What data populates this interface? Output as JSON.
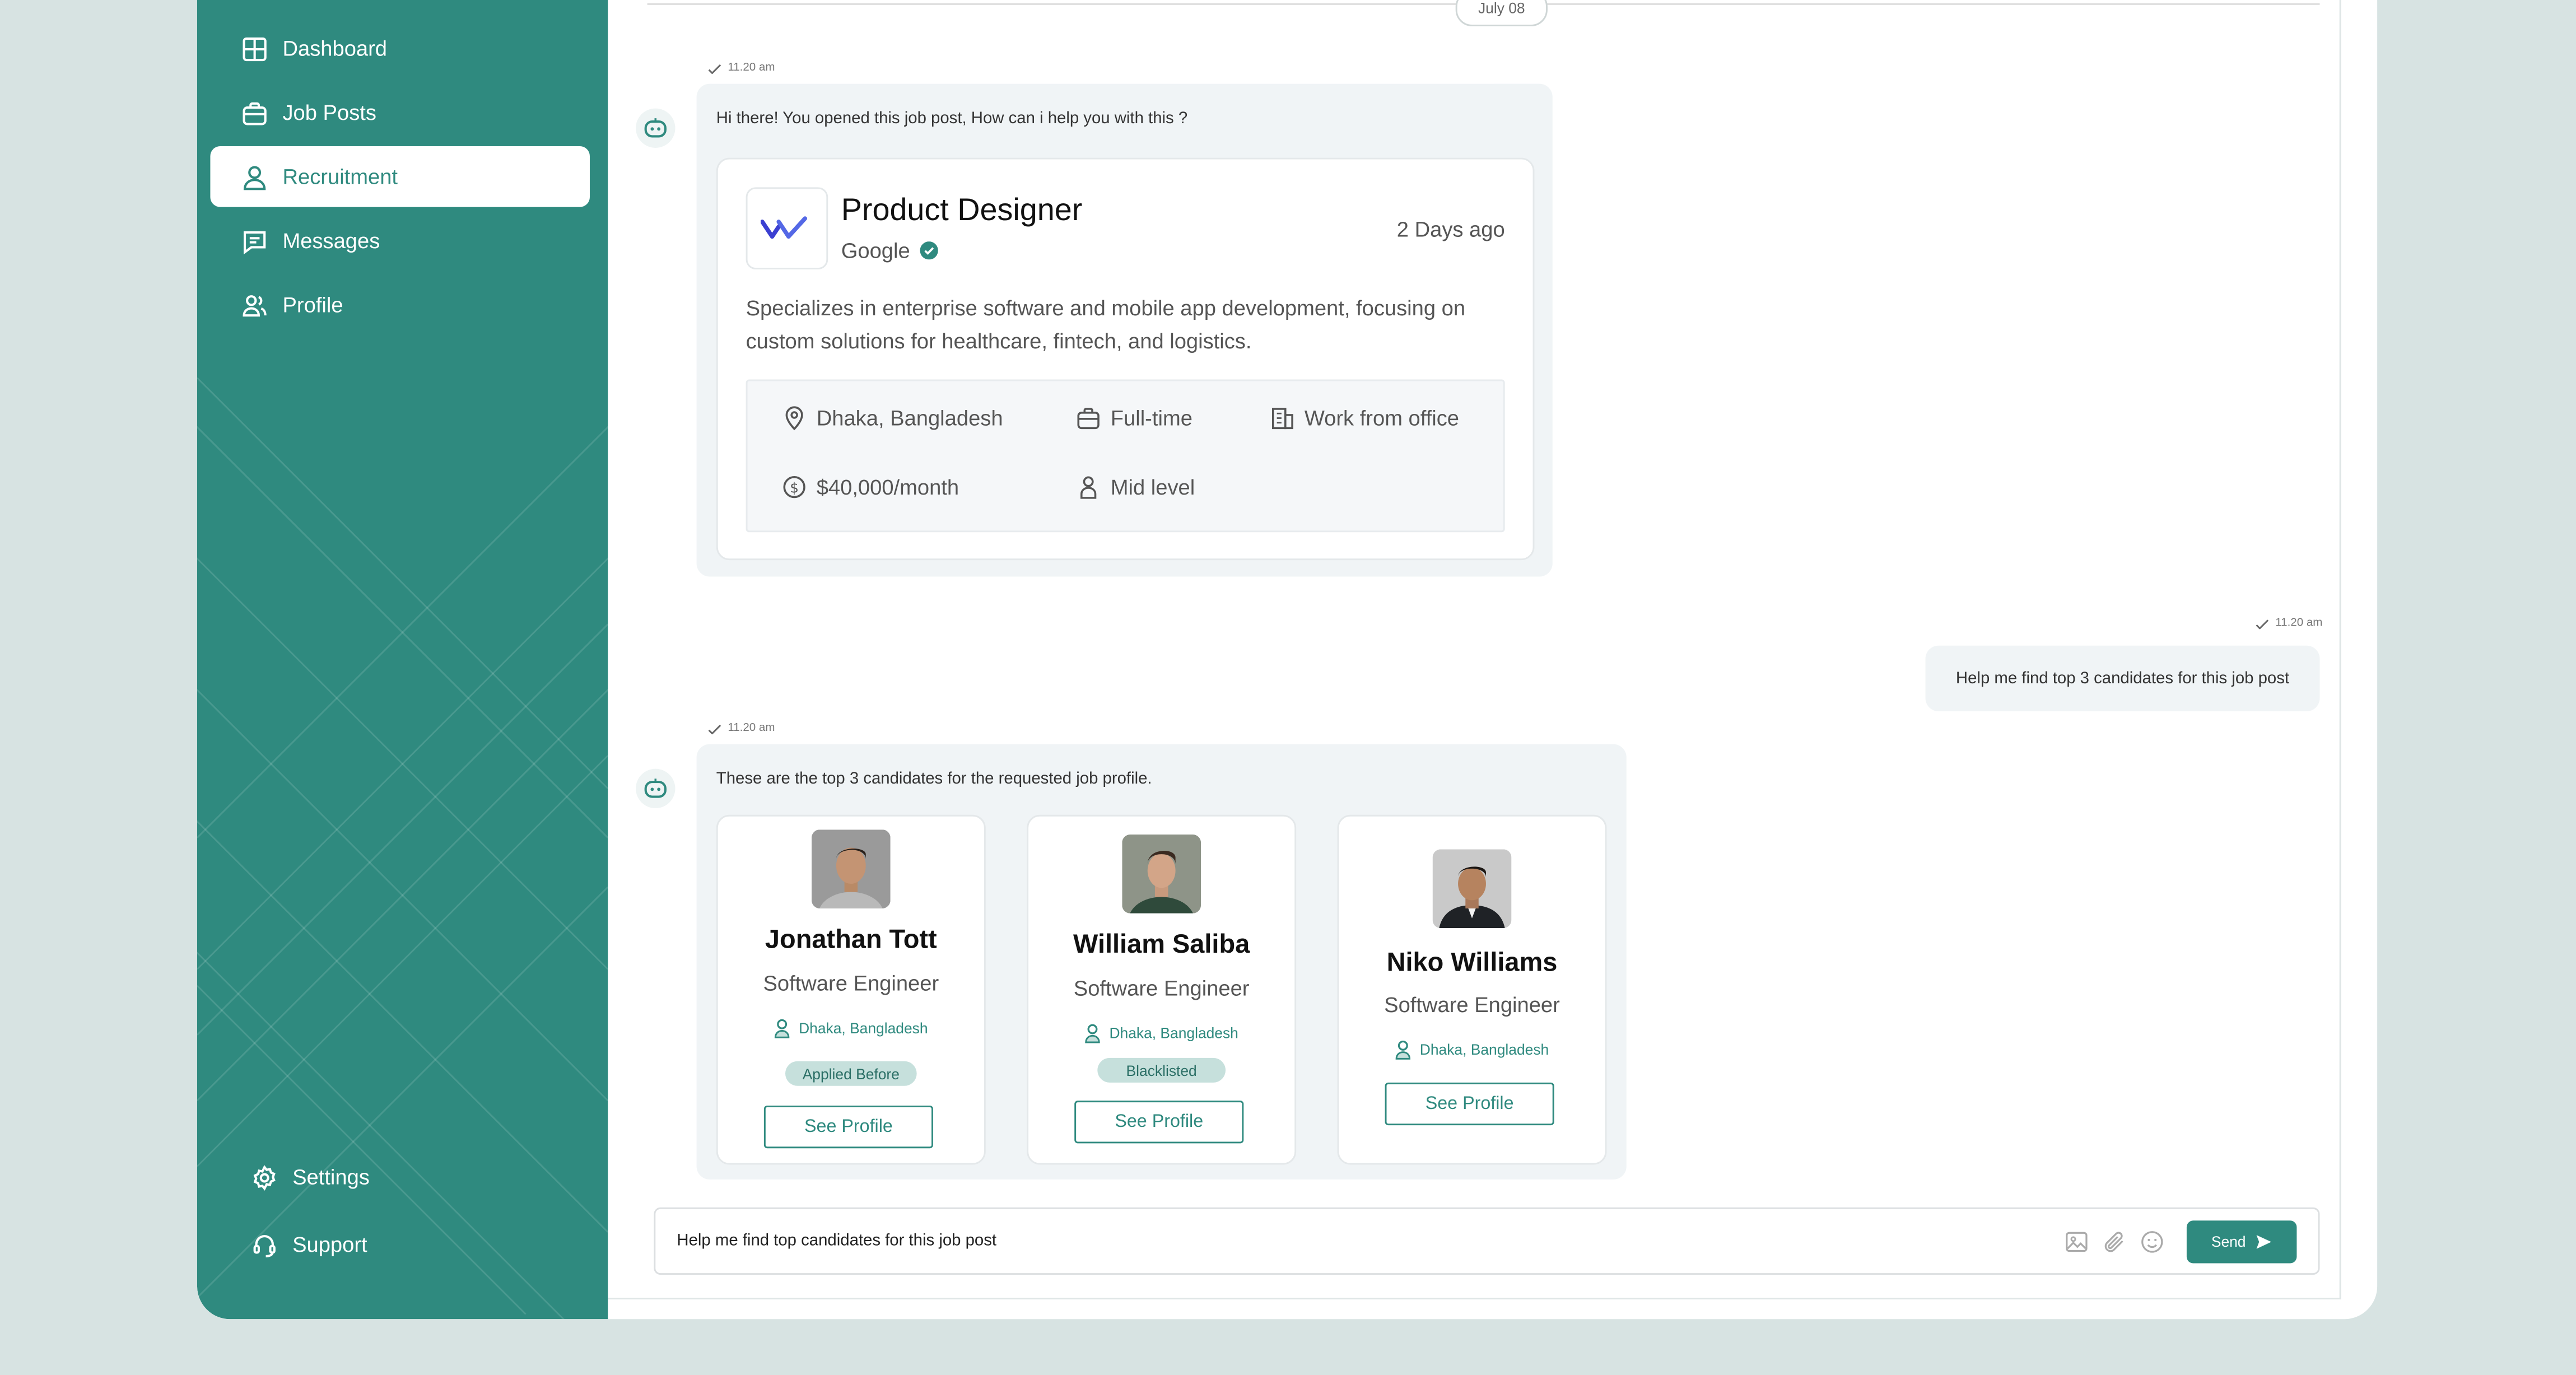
{
  "sidebar": {
    "nav": [
      {
        "label": "Dashboard",
        "icon": "dashboard-icon"
      },
      {
        "label": "Job Posts",
        "icon": "briefcase-icon"
      },
      {
        "label": "Recruitment",
        "icon": "user-icon",
        "active": true
      },
      {
        "label": "Messages",
        "icon": "message-icon"
      },
      {
        "label": "Profile",
        "icon": "users-icon"
      }
    ],
    "bottom": [
      {
        "label": "Settings",
        "icon": "gear-icon"
      },
      {
        "label": "Support",
        "icon": "headset-icon"
      }
    ]
  },
  "chat": {
    "date_separator": "July 08",
    "messages": [
      {
        "from": "bot",
        "time": "11.20 am",
        "text": "Hi there! You opened this job post, How can i help you with this ?"
      },
      {
        "from": "user",
        "time": "11.20 am",
        "text": "Help me find top 3 candidates for this job post"
      },
      {
        "from": "bot",
        "time": "11.20 am",
        "text": "These are the top 3 candidates for the requested job profile."
      }
    ],
    "job": {
      "title": "Product Designer",
      "company": "Google",
      "posted": "2 Days ago",
      "description": "Specializes in enterprise software and mobile app development, focusing on custom solutions for healthcare, fintech, and logistics.",
      "location": "Dhaka, Bangladesh",
      "type": "Full-time",
      "mode": "Work from office",
      "salary": "$40,000/month",
      "level": "Mid level"
    },
    "candidates": [
      {
        "name": "Jonathan Tott",
        "role": "Software Engineer",
        "location": "Dhaka, Bangladesh",
        "badge": "Applied Before",
        "button": "See Profile"
      },
      {
        "name": "William Saliba",
        "role": "Software Engineer",
        "location": "Dhaka, Bangladesh",
        "badge": "Blacklisted",
        "button": "See Profile"
      },
      {
        "name": "Niko Williams",
        "role": "Software Engineer",
        "location": "Dhaka, Bangladesh",
        "badge": null,
        "button": "See Profile"
      }
    ]
  },
  "composer": {
    "value": "Help me find top candidates for this job post",
    "send_label": "Send"
  },
  "colors": {
    "brand": "#2f8a7f",
    "page_bg": "#d7e3e2",
    "bubble_bg": "#f0f4f6",
    "badge_bg": "#c6e0dc"
  }
}
